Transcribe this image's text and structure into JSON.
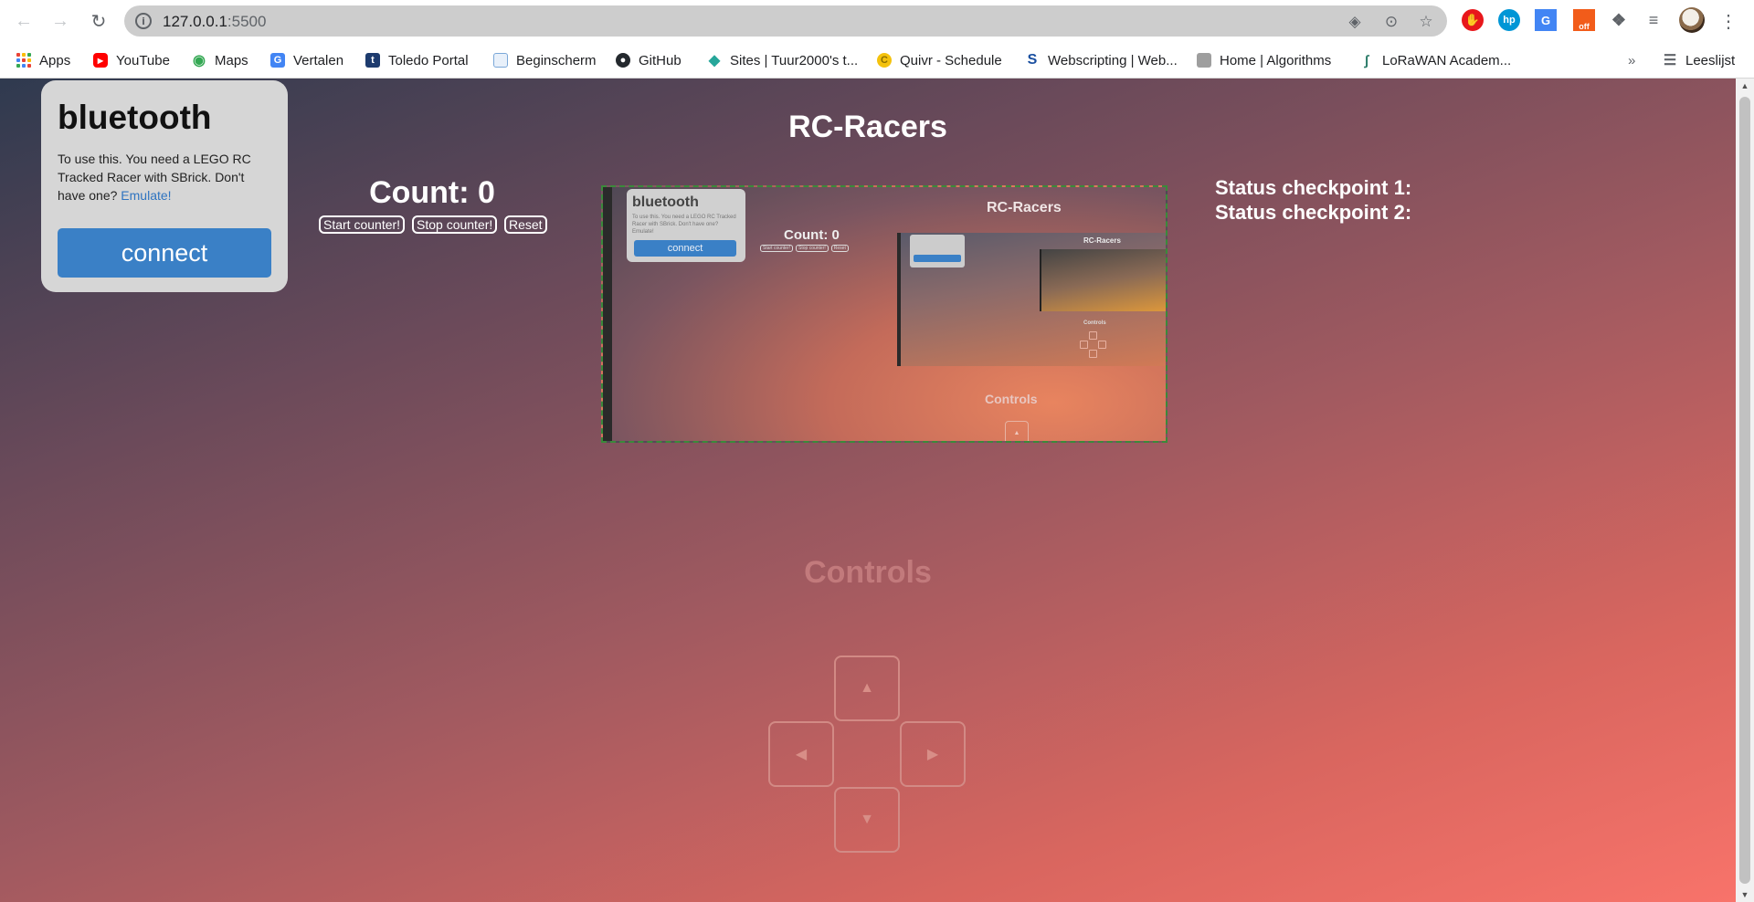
{
  "browser": {
    "url_host": "127.0.0.1",
    "url_port": ":5500",
    "icons": {
      "back": "back-arrow-icon",
      "forward": "forward-arrow-icon",
      "reload": "reload-icon",
      "site_info": "info-icon",
      "translate": "translate-icon",
      "zoom": "zoom-icon",
      "bookmark_star": "star-icon",
      "menu": "kebab-menu-icon"
    },
    "extension_badge": "off"
  },
  "bookmarks": {
    "items": [
      {
        "label": "Apps",
        "icon": "apps-grid-icon"
      },
      {
        "label": "YouTube",
        "icon": "youtube-icon",
        "color": "#ff0000"
      },
      {
        "label": "Maps",
        "icon": "maps-pin-icon",
        "color": "#34a853"
      },
      {
        "label": "Vertalen",
        "icon": "translate-icon",
        "color": "#4285f4"
      },
      {
        "label": "Toledo Portal",
        "icon": "toledo-icon",
        "color": "#1d3b6e"
      },
      {
        "label": "Beginscherm",
        "icon": "page-icon",
        "color": "#7aa7d8"
      },
      {
        "label": "GitHub",
        "icon": "github-icon",
        "color": "#24292e"
      },
      {
        "label": "Sites | Tuur2000's t...",
        "icon": "sites-icon",
        "color": "#26a69a"
      },
      {
        "label": "Quivr - Schedule",
        "icon": "quivr-icon",
        "color": "#f4c20d"
      },
      {
        "label": "Webscripting | Web...",
        "icon": "webscripting-icon",
        "color": "#1a4fa0"
      },
      {
        "label": "Home | Algorithms",
        "icon": "folder-gray-icon",
        "color": "#9e9e9e"
      },
      {
        "label": "LoRaWAN Academ...",
        "icon": "lorawan-icon",
        "color": "#2e7d6b"
      }
    ],
    "overflow": "»",
    "reading_list": "Leeslijst"
  },
  "page": {
    "title": "RC-Racers",
    "bluetooth": {
      "heading": "bluetooth",
      "text": "To use this. You need a LEGO RC Tracked Racer with SBrick. Don't have one?",
      "link": "Emulate!",
      "button": "connect"
    },
    "counter": {
      "text": "Count: 0",
      "start": "Start counter!",
      "stop": "Stop counter!",
      "reset": "Reset"
    },
    "status": {
      "checkpoint1": "Status checkpoint 1:",
      "checkpoint2": "Status checkpoint 2:"
    },
    "feed": {
      "card_heading": "bluetooth",
      "card_text": "To use this. You need a LEGO RC Tracked Racer with SBrick. Don't have one? Emulate!",
      "card_button": "connect",
      "title": "RC-Racers",
      "count": "Count: 0",
      "btns": [
        "Start counter!",
        "Stop counter!",
        "Reset"
      ],
      "controls": "Controls",
      "inner_title": "RC-Racers",
      "inner_controls": "Controls"
    },
    "controls": {
      "title": "Controls",
      "up": "▲",
      "left": "◀",
      "right": "▶",
      "down": "▼"
    }
  },
  "colors": {
    "accent": "#3a80c6",
    "feed_border": "#3a8a3a",
    "gradient_top": "#2f3a4f",
    "gradient_bottom": "#f8736a"
  }
}
